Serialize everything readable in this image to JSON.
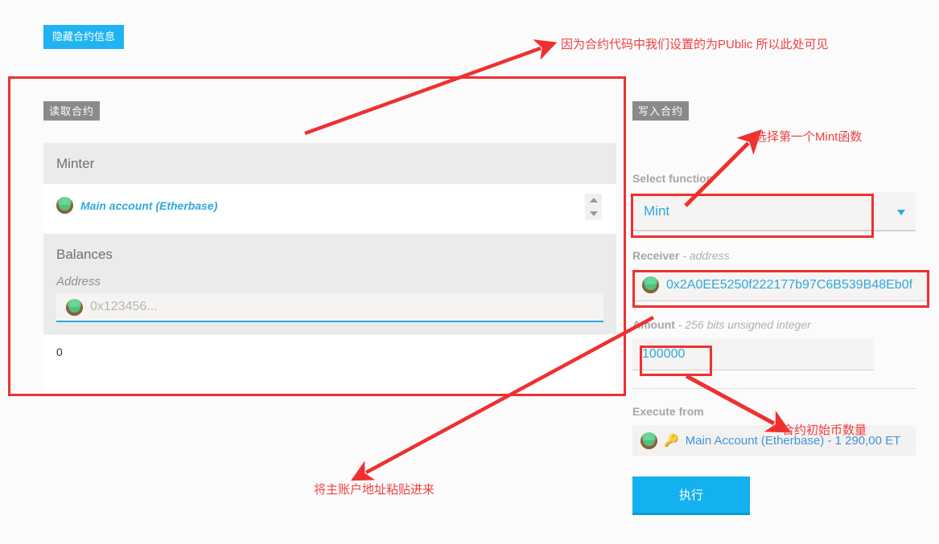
{
  "toolbar": {
    "hide_contract_label": "隐藏合约信息"
  },
  "read_section": {
    "badge": "读取合约",
    "minter": {
      "header": "Minter",
      "account_name": "Main account (Etherbase)",
      "avatar_icon": "identicon-avatar",
      "spinner_up_icon": "caret-up-icon",
      "spinner_down_icon": "caret-down-icon"
    },
    "balances": {
      "header": "Balances",
      "address_label": "Address",
      "address_placeholder": "0x123456...",
      "avatar_icon": "identicon-avatar",
      "result": "0"
    }
  },
  "write_section": {
    "badge": "写入合约",
    "select_function_label": "Select function",
    "selected_function": "Mint",
    "caret_icon": "chevron-down-icon",
    "receiver": {
      "label": "Receiver",
      "type": " - address",
      "value": "0x2A0EE5250f222177b97C6B539B48Eb0f",
      "avatar_icon": "identicon-avatar"
    },
    "amount": {
      "label": "Amount",
      "type": " - 256 bits unsigned integer",
      "value": "100000"
    },
    "execute_from": {
      "label": "Execute from",
      "key_icon": "key-icon",
      "avatar_icon": "identicon-avatar",
      "account": "Main Account (Etherbase) - 1 290,00 ET"
    },
    "execute_button": "执行"
  },
  "annotations": {
    "public_note": "因为合约代码中我们设置的为PUblic 所以此处可见",
    "select_mint_note": "选择第一个Mint函数",
    "paste_address_note": "将主账户地址粘贴进来",
    "initial_amount_note": "合约初始币数量"
  },
  "colors": {
    "accent_blue": "#20b3f2",
    "link_blue": "#2fa8e0",
    "annotation_red": "#ef3030",
    "badge_gray": "#8a8a8a"
  }
}
